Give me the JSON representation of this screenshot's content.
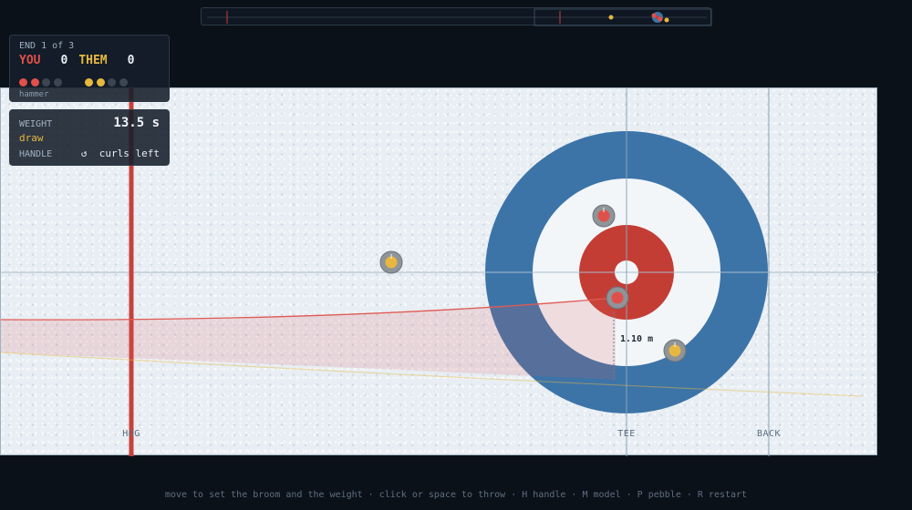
{
  "scoreboard": {
    "end_text": "END 1 of 3",
    "you_label": "YOU",
    "you_score": "0",
    "them_label": "THEM",
    "them_score": "0",
    "you_stones": [
      "thrown",
      "thrown",
      "remaining",
      "remaining"
    ],
    "them_stones": [
      "thrown",
      "thrown",
      "remaining",
      "remaining"
    ],
    "hammer_text": "hammer"
  },
  "throw": {
    "weight_label": "WEIGHT",
    "weight_value": "13.5 s",
    "weight_mode": "draw",
    "handle_label": "HANDLE",
    "handle_icon": "↺",
    "handle_value": "curls left"
  },
  "sheet": {
    "line_labels": {
      "hog": "HOG",
      "tee": "TEE",
      "back": "BACK"
    },
    "distance_readout": "1.10 m"
  },
  "colors": {
    "you": "#e0504a",
    "them": "#e8b740",
    "house_outer": "#3c74a8",
    "house_button": "#c43d35",
    "hog_line": "#c9403a"
  },
  "footer_hint": "move to set the broom and the weight · click or space to throw · H handle · M model · P pebble · R restart"
}
